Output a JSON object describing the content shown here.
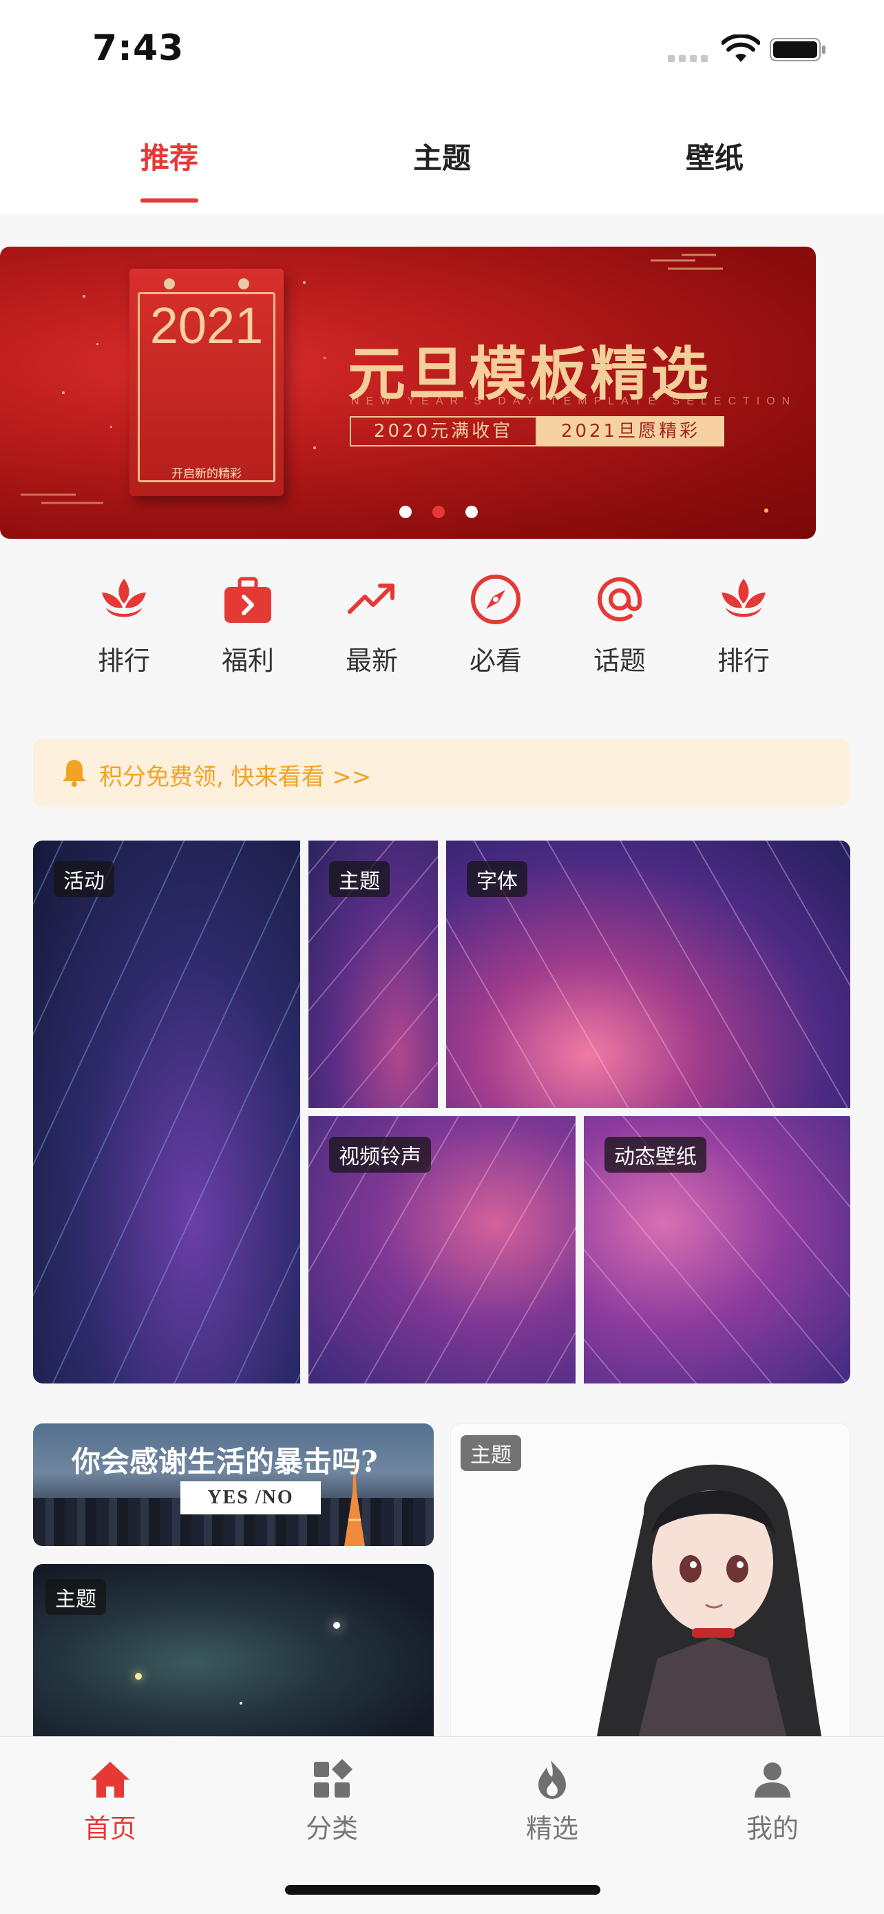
{
  "status_bar": {
    "time": "7:43"
  },
  "top_tabs": [
    {
      "label": "推荐",
      "active": true
    },
    {
      "label": "主题",
      "active": false
    },
    {
      "label": "壁纸",
      "active": false
    }
  ],
  "banner": {
    "calendar_year": "2021",
    "calendar_caption": "开启新的精彩",
    "title": "元旦模板精选",
    "subtitle_en": "NEW YEAR'S DAY TEMPLATE SELECTION",
    "tag_left": "2020元满收官",
    "tag_right": "2021旦愿精彩",
    "slide_count": 3,
    "active_slide": 2
  },
  "quick_nav": [
    {
      "label": "排行",
      "icon": "lotus-icon"
    },
    {
      "label": "福利",
      "icon": "gift-bag-icon"
    },
    {
      "label": "最新",
      "icon": "trending-up-icon"
    },
    {
      "label": "必看",
      "icon": "compass-icon"
    },
    {
      "label": "话题",
      "icon": "at-sign-icon"
    },
    {
      "label": "排行",
      "icon": "lotus-icon"
    }
  ],
  "notice": {
    "text": "积分免费领, 快来看看 >>",
    "icon": "bell-icon"
  },
  "mosaic": {
    "tiles": [
      {
        "tag": "活动"
      },
      {
        "tag": "主题"
      },
      {
        "tag": "字体"
      },
      {
        "tag": "视频铃声"
      },
      {
        "tag": "动态壁纸"
      }
    ]
  },
  "feed": {
    "quote_card": {
      "text": "你会感谢生活的暴击吗?",
      "yes_no": "YES /NO"
    },
    "space_card": {
      "tag": "主题"
    },
    "anime_card": {
      "tag": "主题"
    }
  },
  "bottom_tabs": [
    {
      "label": "首页",
      "icon": "home-icon",
      "active": true
    },
    {
      "label": "分类",
      "icon": "category-icon",
      "active": false
    },
    {
      "label": "精选",
      "icon": "flame-icon",
      "active": false
    },
    {
      "label": "我的",
      "icon": "user-icon",
      "active": false
    }
  ],
  "colors": {
    "accent": "#e53935",
    "notice_text": "#f2a226",
    "notice_bg": "#fdf0dc"
  }
}
